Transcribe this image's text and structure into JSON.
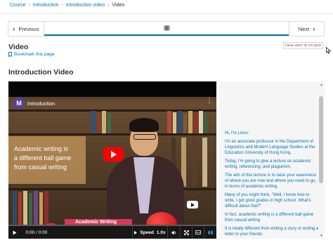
{
  "breadcrumb": {
    "items": [
      "Course",
      "Introduction",
      "Introduction video"
    ],
    "current": "Video",
    "separator": "›"
  },
  "sequence_nav": {
    "previous_label": "Previous",
    "next_label": "Next",
    "tab_icon": "video-icon"
  },
  "unit": {
    "title": "Video",
    "bookmark_label": "Bookmark this page",
    "studio_button": "VIEW UNIT IN STUDIO"
  },
  "section": {
    "title": "Introduction Video"
  },
  "video": {
    "channel_initial": "M",
    "title": "Introduction",
    "overlay_lines": [
      "Academic writing is",
      "a different ball game",
      "from casual writing"
    ],
    "banner_text": "Academic Writing",
    "time_display": "0:00 / 0:00",
    "speed_label": "Speed",
    "speed_value": "1.0x",
    "progress_fraction": 0
  },
  "transcript": {
    "lines": [
      "Hi, I'm Lixun.",
      "I'm an associate professor in the Department of Linguistics and Modern Language Studies at the Education University of Hong Kong.",
      "Today, I'm going to give a lecture on academic writing, referencing, and plagiarism.",
      "The aim of this lecture is to raise your awareness of where you are now and where you need to go, in terms of academic writing.",
      "Many of you might think, \"Well, I know how to write. I got good grades in high school. What's difficult about that?\"",
      "In fact, academic writing is a different ball game from casual writing.",
      "It is totally different from writing a story or writing a letter to your friends."
    ]
  },
  "colors": {
    "link": "#0075b4",
    "studio_text": "#a0303b",
    "youtube_red": "#ff0000",
    "transcript_bg": "#f5f5f5"
  }
}
